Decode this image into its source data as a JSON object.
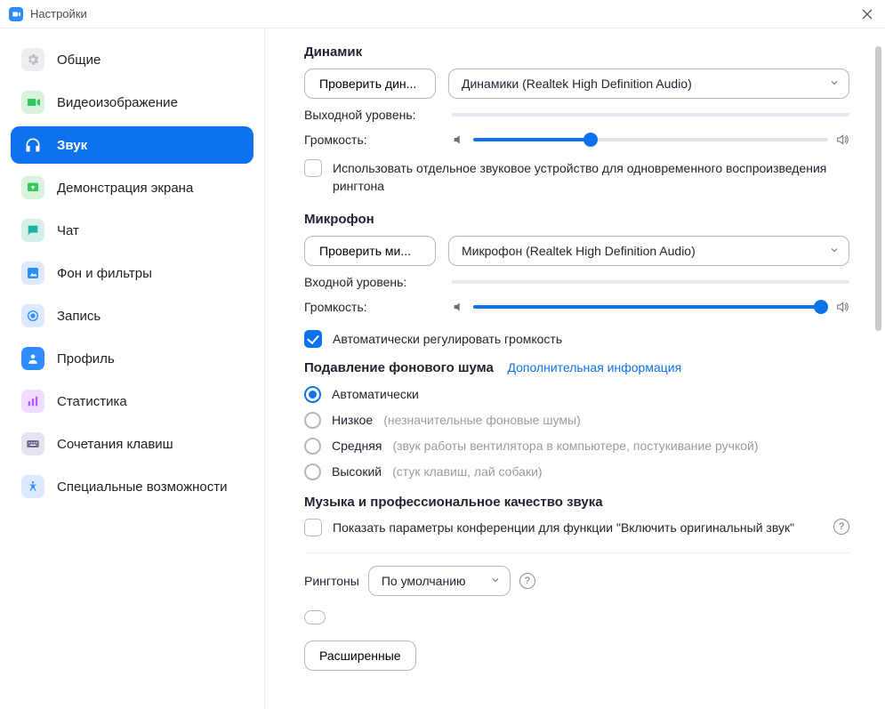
{
  "window": {
    "title": "Настройки"
  },
  "sidebar": {
    "items": [
      {
        "label": "Общие"
      },
      {
        "label": "Видеоизображение"
      },
      {
        "label": "Звук"
      },
      {
        "label": "Демонстрация экрана"
      },
      {
        "label": "Чат"
      },
      {
        "label": "Фон и фильтры"
      },
      {
        "label": "Запись"
      },
      {
        "label": "Профиль"
      },
      {
        "label": "Статистика"
      },
      {
        "label": "Сочетания клавиш"
      },
      {
        "label": "Специальные возможности"
      }
    ]
  },
  "speaker": {
    "heading": "Динамик",
    "test_button": "Проверить дин...",
    "device": "Динамики (Realtek High Definition Audio)",
    "output_level_label": "Выходной уровень:",
    "volume_label": "Громкость:",
    "volume_pct": 33,
    "ringtone_checkbox": "Использовать отдельное звуковое устройство для одновременного воспроизведения рингтона"
  },
  "microphone": {
    "heading": "Микрофон",
    "test_button": "Проверить ми...",
    "device": "Микрофон (Realtek High Definition Audio)",
    "input_level_label": "Входной уровень:",
    "volume_label": "Громкость:",
    "volume_pct": 98,
    "auto_adjust": "Автоматически регулировать громкость"
  },
  "noise": {
    "heading": "Подавление фонового шума",
    "more_info": "Дополнительная информация",
    "options": [
      {
        "label": "Автоматически",
        "hint": ""
      },
      {
        "label": "Низкое",
        "hint": "(незначительные фоновые шумы)"
      },
      {
        "label": "Средняя",
        "hint": "(звук работы вентилятора в компьютере, постукивание ручкой)"
      },
      {
        "label": "Высокий",
        "hint": "(стук клавиш, лай собаки)"
      }
    ]
  },
  "music": {
    "heading": "Музыка и профессиональное качество звука",
    "original_sound": "Показать параметры конференции для функции \"Включить оригинальный звук\""
  },
  "ringtones": {
    "label": "Рингтоны",
    "selected": "По умолчанию"
  },
  "advanced_button": "Расширенные"
}
